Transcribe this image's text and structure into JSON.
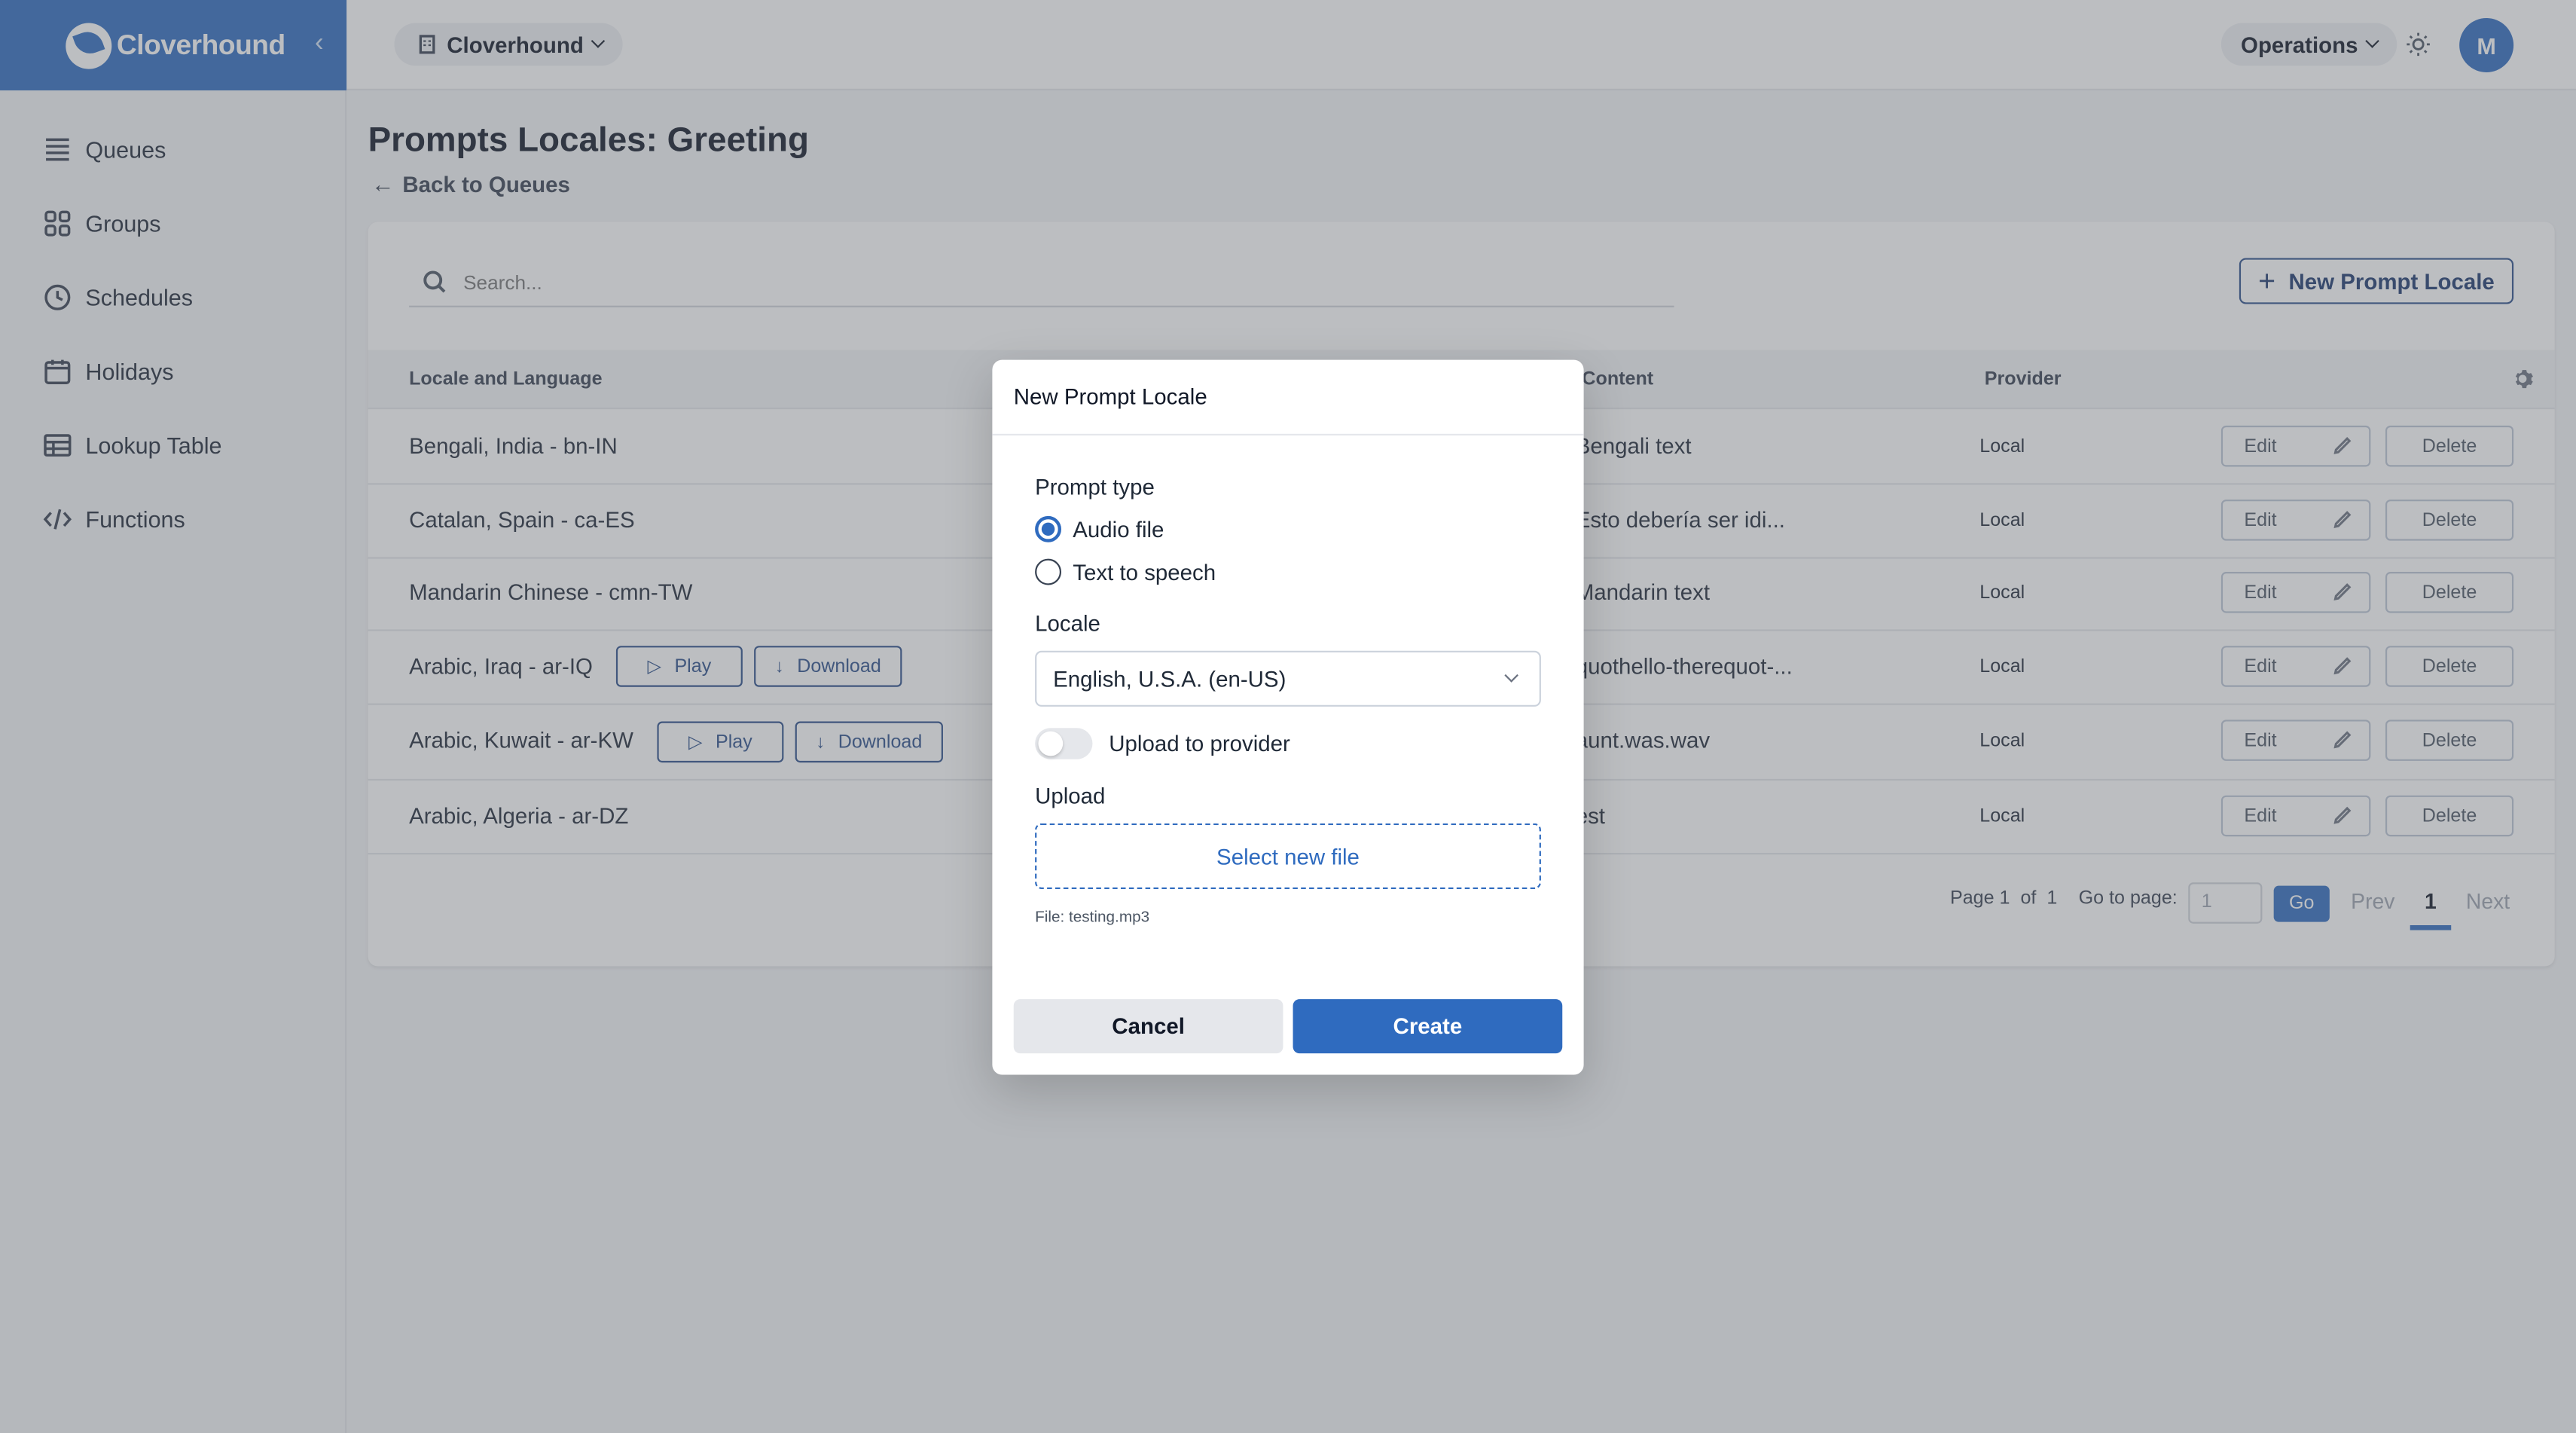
{
  "brand": {
    "name": "Cloverhound"
  },
  "sidebar": {
    "items": [
      {
        "label": "Queues"
      },
      {
        "label": "Groups"
      },
      {
        "label": "Schedules"
      },
      {
        "label": "Holidays"
      },
      {
        "label": "Lookup Table"
      },
      {
        "label": "Functions"
      }
    ]
  },
  "topbar": {
    "org": "Cloverhound",
    "workspace": "Operations",
    "avatar_initial": "M"
  },
  "page": {
    "title": "Prompts Locales: Greeting",
    "back_label": "Back to Queues"
  },
  "toolbar": {
    "search_placeholder": "Search...",
    "new_label": "New Prompt Locale"
  },
  "table": {
    "headers": {
      "locale": "Locale and Language",
      "content": "Content",
      "provider": "Provider"
    },
    "rows": [
      {
        "locale": "Bengali, India - bn-IN",
        "content": "Bengali text",
        "provider": "Local"
      },
      {
        "locale": "Catalan, Spain - ca-ES",
        "content": "Esto debería ser idi...",
        "provider": "Local"
      },
      {
        "locale": "Mandarin Chinese - cmn-TW",
        "content": "Mandarin text",
        "provider": "Local"
      },
      {
        "locale": "Arabic, Iraq - ar-IQ",
        "content": "quothello-therequot-...",
        "provider": "Local"
      },
      {
        "locale": "Arabic, Kuwait - ar-KW",
        "content": "aunt.was.wav",
        "provider": "Local"
      },
      {
        "locale": "Arabic, Algeria - ar-DZ",
        "content": "est",
        "provider": "Local"
      }
    ],
    "play_label": "Play",
    "download_label": "Download",
    "edit_label": "Edit",
    "delete_label": "Delete"
  },
  "pagination": {
    "page_label": "Page",
    "current": "1",
    "of_label": "of",
    "total": "1",
    "goto_label": "Go to page:",
    "goto_value": "1",
    "go_label": "Go",
    "prev_label": "Prev",
    "next_label": "Next"
  },
  "modal": {
    "title": "New Prompt Locale",
    "prompt_type_label": "Prompt type",
    "option_audio": "Audio file",
    "option_tts": "Text to speech",
    "selected_option": "Audio file",
    "locale_label": "Locale",
    "locale_value": "English, U.S.A. (en-US)",
    "upload_toggle_label": "Upload to provider",
    "upload_toggle_on": false,
    "upload_label": "Upload",
    "select_file_label": "Select new file",
    "file_info": "File: testing.mp3",
    "cancel_label": "Cancel",
    "create_label": "Create"
  },
  "colors": {
    "accent": "#2f6bbf",
    "outline": "#2b4f8a"
  }
}
